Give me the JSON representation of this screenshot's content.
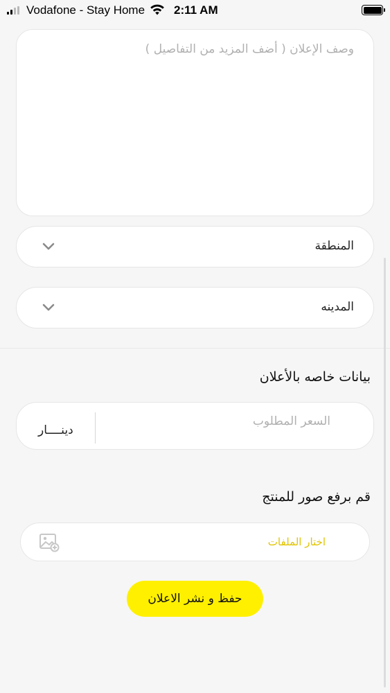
{
  "status_bar": {
    "carrier": "Vodafone - Stay Home",
    "time": "2:11 AM"
  },
  "form": {
    "description_placeholder": "وصف الإعلان ( أضف المزيد من التفاصيل )",
    "region_label": "المنطقة",
    "city_label": "المدينه",
    "ad_data_title": "بيانات خاصه بالأعلان",
    "price_placeholder": "السعر المطلوب",
    "currency": "دينــــار",
    "upload_title": "قم برفع صور للمنتج",
    "choose_files": "اختار الملفات",
    "publish_button": "حفظ و نشر الاعلان"
  },
  "colors": {
    "accent_yellow": "#fff000",
    "file_label": "#e1c400",
    "background": "#f6f6f6"
  },
  "icons": {
    "dropdown": "chevron-down-icon",
    "upload": "image-add-icon",
    "wifi": "wifi-icon",
    "battery": "battery-icon",
    "signal": "signal-icon"
  }
}
